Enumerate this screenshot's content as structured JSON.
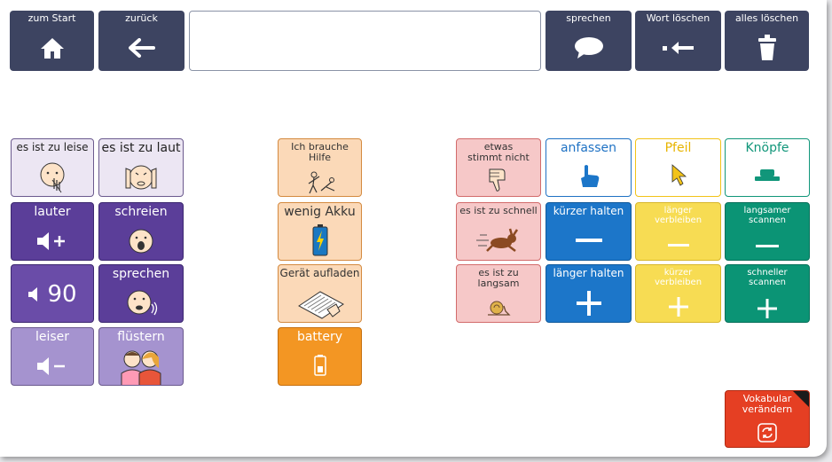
{
  "toolbar": {
    "home_label": "zum Start",
    "back_label": "zurück",
    "speak_label": "sprechen",
    "delete_word_label": "Wort löschen",
    "clear_all_label": "alles löschen",
    "text_value": ""
  },
  "grid": {
    "es_ist_zu_leise": "es ist zu leise",
    "es_ist_zu_laut": "es ist zu laut",
    "lauter": "lauter",
    "schreien": "schreien",
    "volume_value": "90",
    "sprechen": "sprechen",
    "leiser": "leiser",
    "fluestern": "flüstern",
    "ich_brauche_hilfe": "Ich brauche Hilfe",
    "wenig_akku": "wenig Akku",
    "geraet_aufladen": "Gerät aufladen",
    "battery": "battery",
    "etwas_stimmt_nicht": "etwas stimmt nicht",
    "es_ist_zu_schnell": "es ist zu schnell",
    "es_ist_zu_langsam": "es ist zu langsam",
    "anfassen": "anfassen",
    "kuerzer_halten": "kürzer halten",
    "laenger_halten": "länger halten",
    "pfeil": "Pfeil",
    "laenger_verbleiben": "länger verbleiben",
    "kuerzer_verbleiben": "kürzer verbleiben",
    "knoepfe": "Knöpfe",
    "langsamer_scannen": "langsamer scannen",
    "schneller_scannen": "schneller scannen",
    "vokabular_veraendern": "Vokabular verändern"
  },
  "icons": [
    "home-icon",
    "arrow-left-icon",
    "speech-bubble-icon",
    "backspace-arrow-icon",
    "trash-icon",
    "speaker-plus-icon",
    "speaker-minus-icon",
    "speaker-icon",
    "battery-icon",
    "refresh-icon",
    "hand-pointer-icon",
    "cursor-arrow-icon",
    "button-icon",
    "minus-icon",
    "plus-icon"
  ],
  "colors": {
    "nav": "#3d4461",
    "purple": "#5b3e99",
    "lavender": "#a593cf",
    "peach": "#fbd9b8",
    "orange": "#f39623",
    "rose": "#f6c8c8",
    "blue": "#1c76c9",
    "yellow": "#f7dc53",
    "green": "#0b9475",
    "red": "#e53f23"
  }
}
